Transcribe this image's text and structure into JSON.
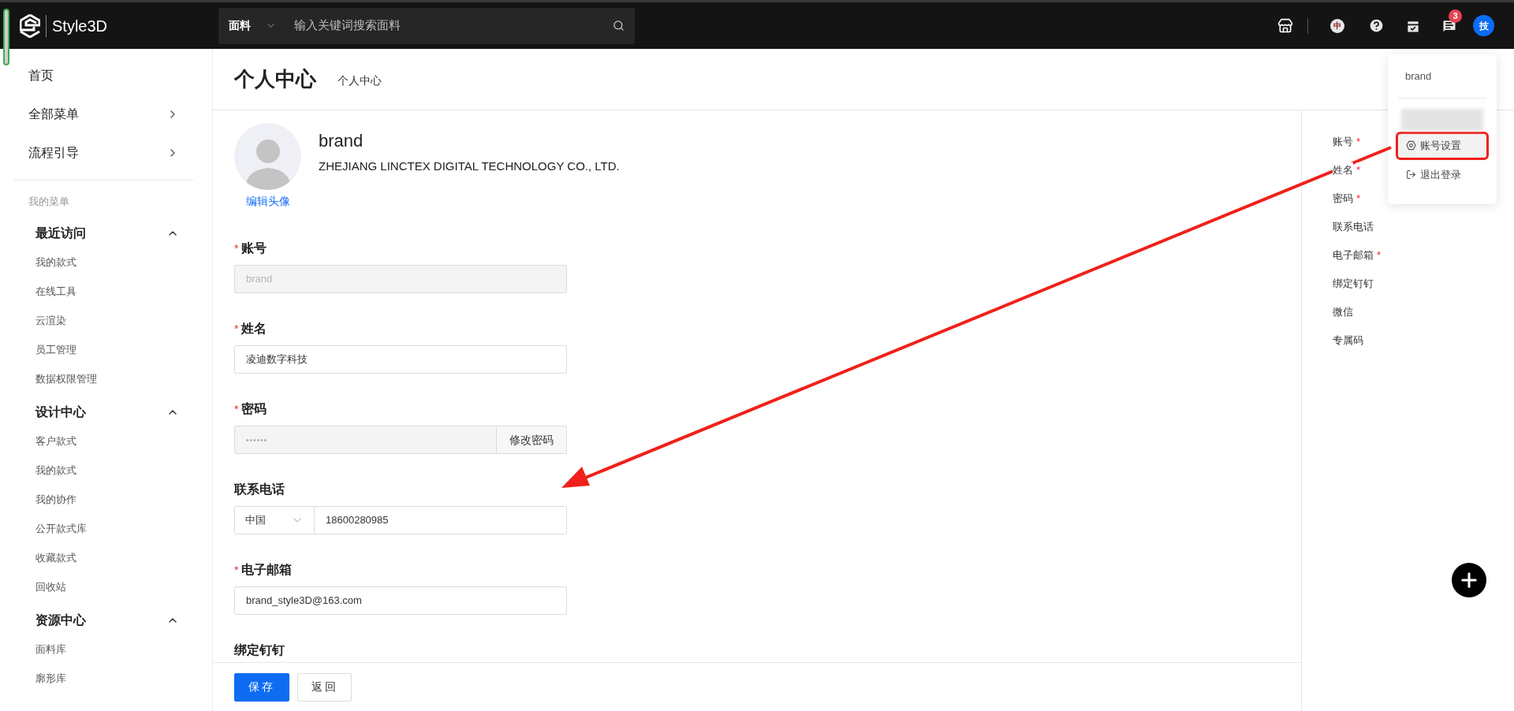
{
  "topbar": {
    "logo": "Style3D",
    "search": {
      "category": "面料",
      "placeholder": "输入关键词搜索面料"
    },
    "language": "中",
    "notification_count": "3",
    "avatar": "技"
  },
  "sidebar": {
    "top_items": [
      {
        "label": "首页",
        "has_arrow": false
      },
      {
        "label": "全部菜单",
        "has_arrow": true
      },
      {
        "label": "流程引导",
        "has_arrow": true
      }
    ],
    "section_title": "我的菜单",
    "groups": [
      {
        "title": "最近访问",
        "expanded": true,
        "items": [
          "我的款式",
          "在线工具",
          "云渲染",
          "员工管理",
          "数据权限管理"
        ]
      },
      {
        "title": "设计中心",
        "expanded": true,
        "items": [
          "客户款式",
          "我的款式",
          "我的协作",
          "公开款式库",
          "收藏款式",
          "回收站"
        ]
      },
      {
        "title": "资源中心",
        "expanded": true,
        "items": [
          "面料库",
          "廓形库"
        ]
      }
    ]
  },
  "page": {
    "title": "个人中心",
    "breadcrumb": "个人中心"
  },
  "profile": {
    "name": "brand",
    "company": "ZHEJIANG LINCTEX DIGITAL TECHNOLOGY CO., LTD.",
    "edit_avatar": "编辑头像"
  },
  "fields": [
    {
      "kind": "text",
      "label": "账号",
      "marker": "*",
      "value": "brand",
      "disabled": true
    },
    {
      "kind": "text",
      "label": "姓名",
      "marker": "*",
      "value": "凌迪数字科技",
      "disabled": false
    },
    {
      "kind": "password",
      "label": "密码",
      "marker": "*",
      "value": "••••••",
      "action": "修改密码"
    },
    {
      "kind": "phone",
      "label": "联系电话",
      "country": "中国",
      "value": "18600280985"
    },
    {
      "kind": "text",
      "label": "电子邮箱",
      "marker": "*",
      "value": "brand_style3D@163.com",
      "disabled": false
    },
    {
      "kind": "binding",
      "label": "绑定钉钉"
    }
  ],
  "footer": {
    "buttons": [
      {
        "label": "保存",
        "primary": true
      },
      {
        "label": "返回",
        "primary": false
      }
    ]
  },
  "anchors": [
    {
      "label": "账号",
      "marker": "*"
    },
    {
      "label": "姓名",
      "marker": "*"
    },
    {
      "label": "密码",
      "marker": "*"
    },
    {
      "label": "联系电话"
    },
    {
      "label": "电子邮箱",
      "marker": "*"
    },
    {
      "label": "绑定钉钉"
    },
    {
      "label": "微信"
    },
    {
      "label": "专属码"
    }
  ],
  "user_menu": {
    "name": "brand",
    "items": [
      {
        "kind": "settings",
        "label": "账号设置",
        "highlighted": true
      },
      {
        "kind": "logout",
        "label": "退出登录",
        "highlighted": false
      }
    ]
  }
}
